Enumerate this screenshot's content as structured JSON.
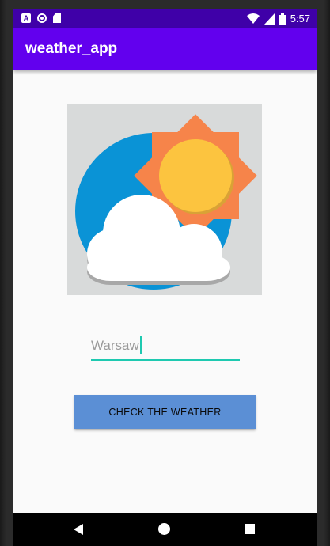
{
  "status_bar": {
    "notification_icons": [
      "a-icon",
      "circle-icon",
      "sd-card-icon"
    ],
    "right_icons": [
      "wifi-icon",
      "signal-icon",
      "battery-icon"
    ],
    "time": "5:57",
    "color": "#3f00a8"
  },
  "app_bar": {
    "title": "weather_app",
    "color": "#6200ee"
  },
  "main": {
    "image_icon": "weather-sun-cloud-icon",
    "city_input": {
      "value": "Warsaw",
      "accent_color": "#1ec9b0"
    },
    "check_button": {
      "label": "CHECK THE WEATHER",
      "color": "#5b8fd5"
    }
  },
  "nav_bar": {
    "icons": [
      "back-icon",
      "home-icon",
      "recents-icon"
    ]
  }
}
